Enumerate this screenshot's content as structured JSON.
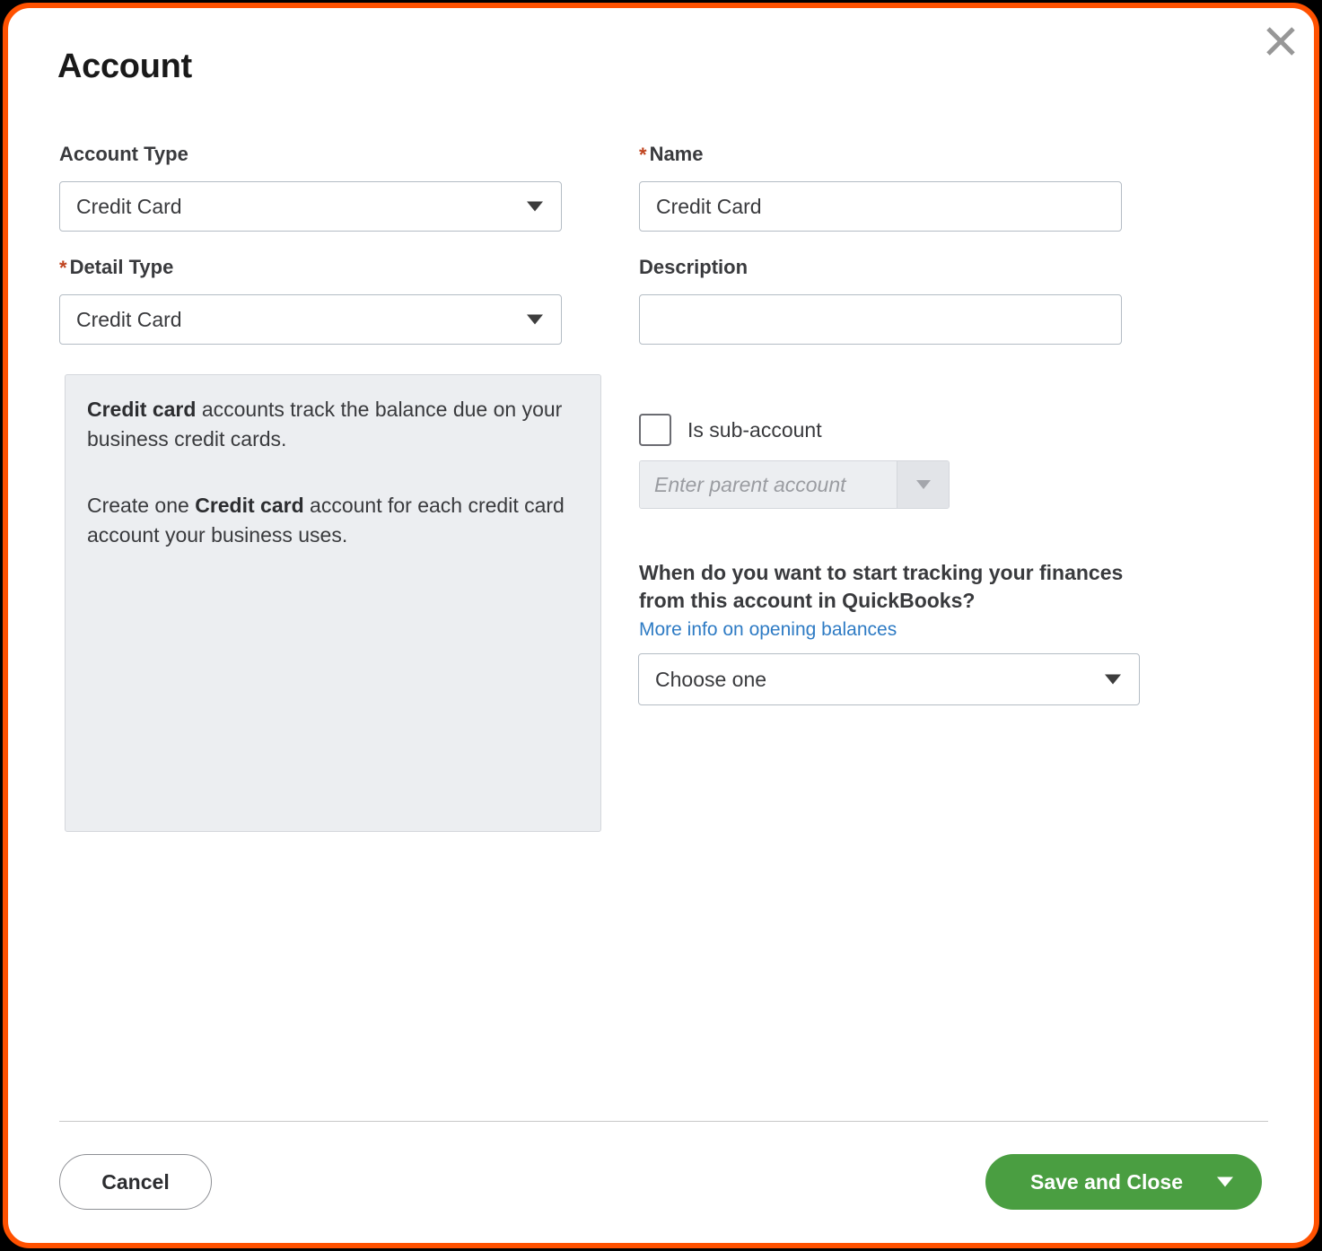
{
  "dialog": {
    "title": "Account",
    "close_icon": "close-icon",
    "accent_color": "#ff5100"
  },
  "left_column": {
    "account_type": {
      "label": "Account Type",
      "required": false,
      "value": "Credit Card",
      "caret_icon": "chevron-down-icon"
    },
    "detail_type": {
      "label": "Detail Type",
      "required": true,
      "required_marker": "*",
      "value": "Credit Card",
      "caret_icon": "chevron-down-icon"
    },
    "info_panel": {
      "paragraph_1_bold": "Credit card",
      "paragraph_1_rest": " accounts track the balance due on your business credit cards.",
      "paragraph_2_pre": "Create one ",
      "paragraph_2_bold": "Credit card",
      "paragraph_2_rest": " account for each credit card account your business uses."
    }
  },
  "right_column": {
    "name": {
      "label": "Name",
      "required": true,
      "required_marker": "*",
      "value": "Credit Card",
      "placeholder": ""
    },
    "description": {
      "label": "Description",
      "required": false,
      "value": "",
      "placeholder": ""
    },
    "sub_account": {
      "checkbox_label": "Is sub-account",
      "checked": false,
      "parent_account_placeholder": "Enter parent account",
      "parent_account_value": "",
      "parent_account_disabled": true,
      "caret_icon": "chevron-down-icon"
    },
    "tracking": {
      "question": "When do you want to start tracking your finances from this account in QuickBooks?",
      "link_text": "More info on opening balances",
      "link_color": "#2e7bc4",
      "select_value": "Choose one",
      "caret_icon": "chevron-down-icon"
    }
  },
  "footer": {
    "cancel_label": "Cancel",
    "save_label": "Save and Close",
    "save_caret_icon": "chevron-down-icon",
    "save_color": "#4a9e41"
  }
}
